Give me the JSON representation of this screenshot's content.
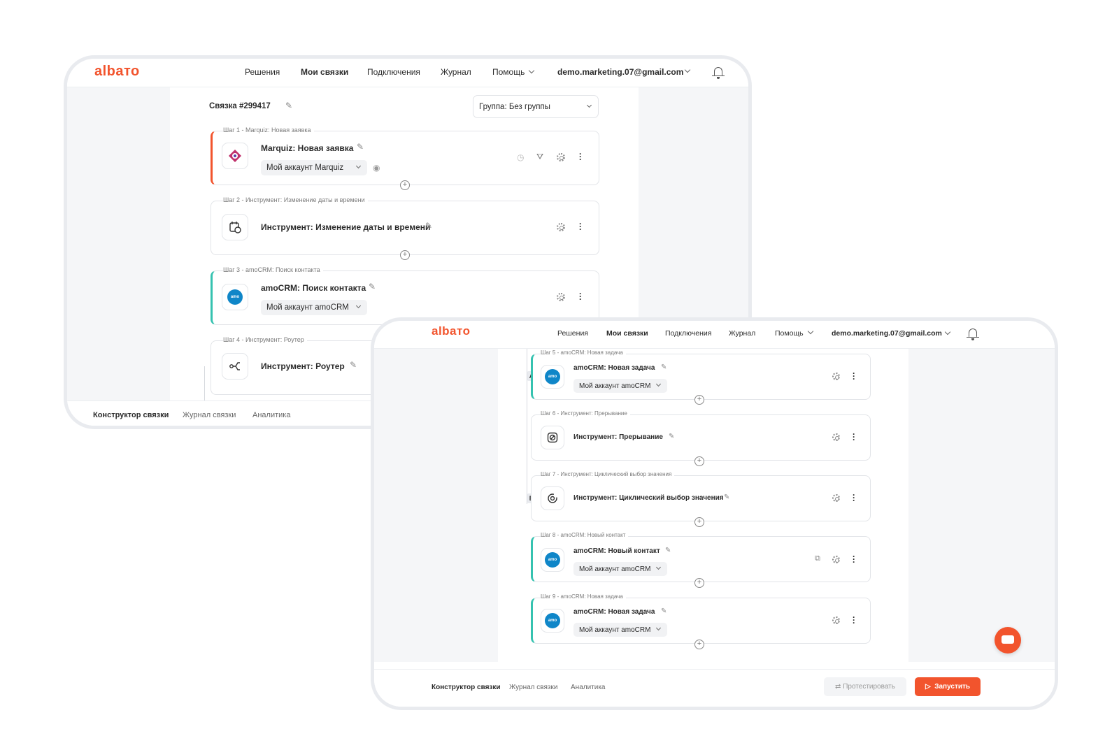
{
  "nav": {
    "logo": "albaто",
    "items": [
      "Решения",
      "Мои связки",
      "Подключения",
      "Журнал",
      "Помощь"
    ],
    "email": "demo.marketing.07@gmail.com"
  },
  "bundle": {
    "title": "Связка #299417",
    "group": "Группа: Без группы"
  },
  "steps": [
    {
      "label": "Шаг 1 - Marquiz: Новая заявка",
      "title": "Marquiz: Новая заявка",
      "account": "Мой аккаунт Marquiz"
    },
    {
      "label": "Шаг 2 - Инструмент: Изменение даты и времени",
      "title": "Инструмент: Изменение даты и времени"
    },
    {
      "label": "Шаг 3 - amoCRM: Поиск контакта",
      "title": "amoCRM: Поиск контакта",
      "account": "Мой аккаунт amoCRM"
    },
    {
      "label": "Шаг 4 - Инструмент: Роутер",
      "title": "Инструмент: Роутер"
    },
    {
      "label": "Шаг 5 - amoCRM: Новая задача",
      "title": "amoCRM: Новая задача",
      "account": "Мой аккаунт amoCRM"
    },
    {
      "label": "Шаг 6 - Инструмент: Прерывание",
      "title": "Инструмент: Прерывание"
    },
    {
      "label": "Шаг 7 - Инструмент: Циклический выбор значения",
      "title": "Инструмент: Циклический выбор значения"
    },
    {
      "label": "Шаг 8 - amoCRM: Новый контакт",
      "title": "amoCRM: Новый контакт",
      "account": "Мой аккаунт amoCRM"
    },
    {
      "label": "Шаг 9 - amoCRM: Новая задача",
      "title": "amoCRM: Новая задача",
      "account": "Мой аккаунт amoCRM"
    }
  ],
  "branches": [
    "A",
    "B"
  ],
  "amo_badge": "amo",
  "tabs": [
    "Конструктор связки",
    "Журнал связки",
    "Аналитика"
  ],
  "buttons": {
    "test": "Протестировать",
    "run": "Запустить"
  },
  "colors": {
    "brand": "#f2542d",
    "amo": "#0f86c8",
    "teal": "#35c2b0"
  }
}
